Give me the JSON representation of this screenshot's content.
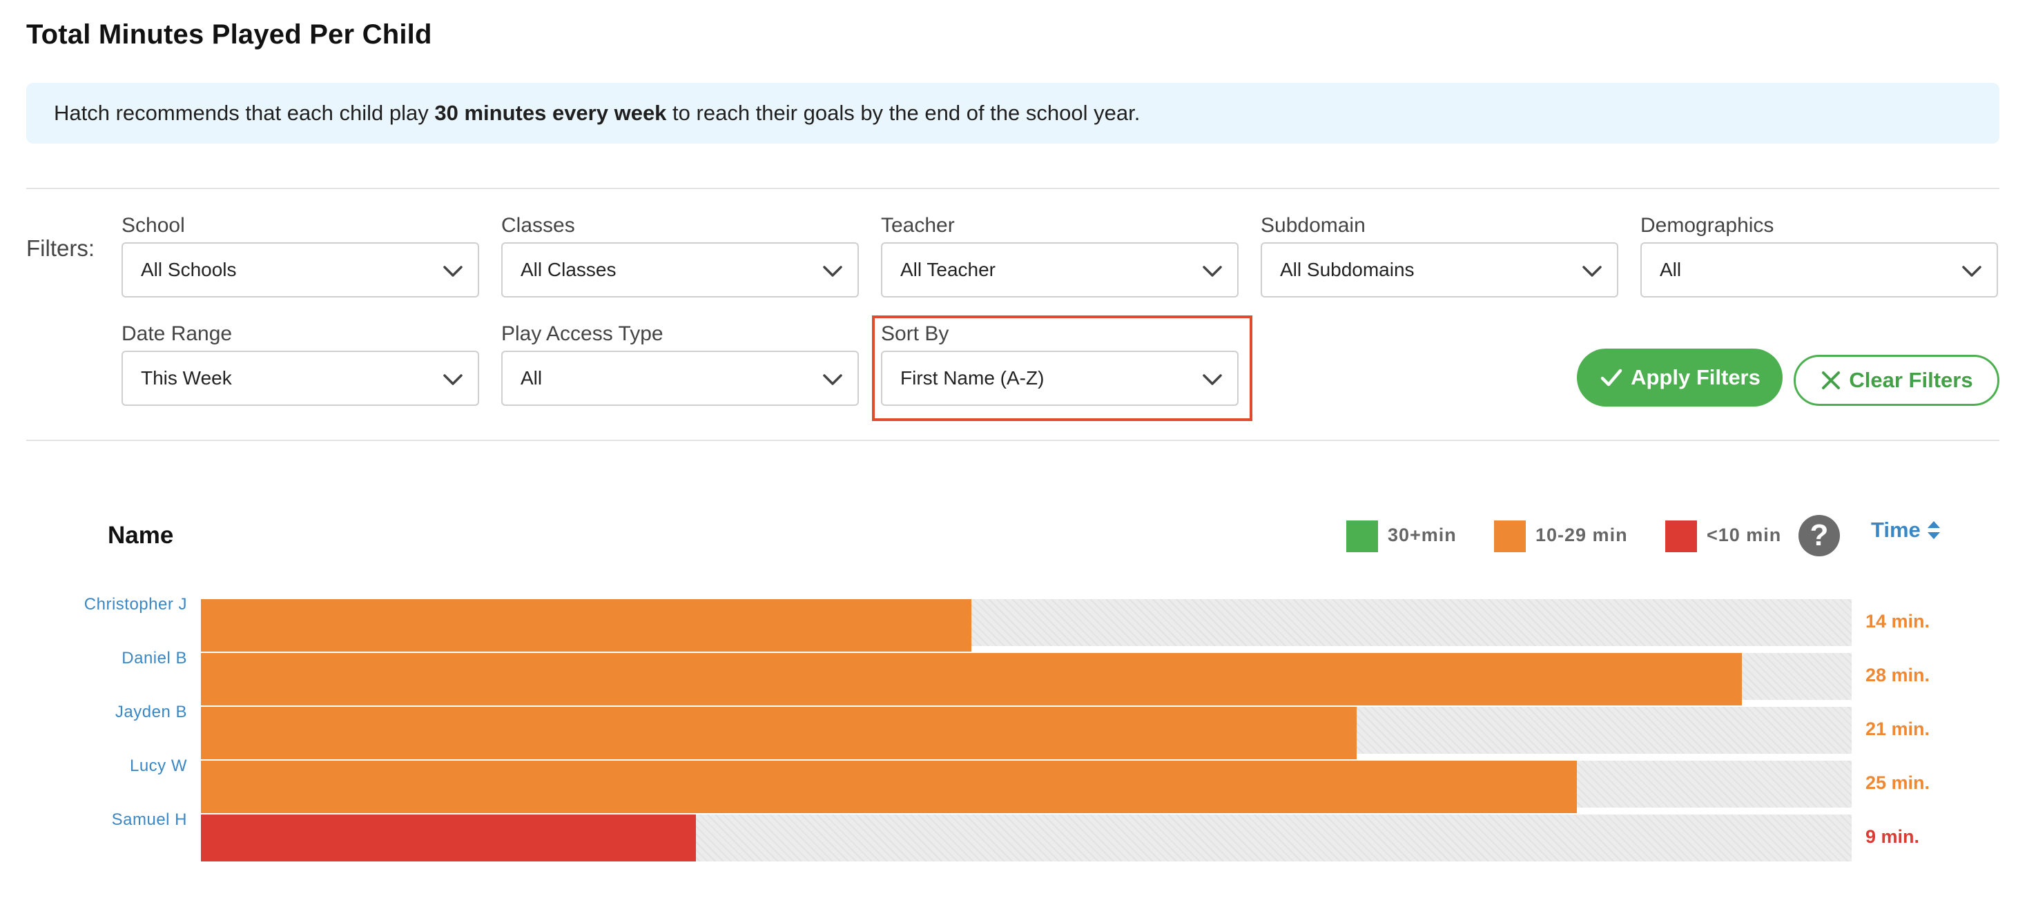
{
  "page": {
    "title": "Total Minutes Played Per Child"
  },
  "banner": {
    "prefix": "Hatch recommends that each child play ",
    "bold": "30 minutes every week",
    "suffix": " to reach their goals by the end of the school year."
  },
  "filters": {
    "label": "Filters:",
    "school": {
      "label": "School",
      "value": "All Schools"
    },
    "classes": {
      "label": "Classes",
      "value": "All Classes"
    },
    "teacher": {
      "label": "Teacher",
      "value": "All Teacher"
    },
    "subdomain": {
      "label": "Subdomain",
      "value": "All Subdomains"
    },
    "demographics": {
      "label": "Demographics",
      "value": "All"
    },
    "date_range": {
      "label": "Date Range",
      "value": "This Week"
    },
    "play_access_type": {
      "label": "Play Access Type",
      "value": "All"
    },
    "sort_by": {
      "label": "Sort By",
      "value": "First Name (A-Z)"
    },
    "apply_label": "Apply Filters",
    "clear_label": "Clear Filters"
  },
  "chart_header": {
    "name_label": "Name",
    "time_label": "Time",
    "legend": [
      {
        "label": "30+min",
        "color": "#4caf50"
      },
      {
        "label": "10-29 min",
        "color": "#ef8833"
      },
      {
        "label": "<10 min",
        "color": "#db3b33"
      }
    ],
    "help_icon": "question-circle-icon",
    "sort_icon": "sort-arrows-icon"
  },
  "chart_data": {
    "type": "bar",
    "orientation": "horizontal",
    "categories": [
      "Christopher J",
      "Daniel B",
      "Jayden B",
      "Lucy W",
      "Samuel H"
    ],
    "values": [
      14,
      28,
      21,
      25,
      9
    ],
    "value_labels": [
      "14 min.",
      "28 min.",
      "21 min.",
      "25 min.",
      "9 min."
    ],
    "xlim": [
      0,
      30
    ],
    "colors": [
      "#ef8833",
      "#ef8833",
      "#ef8833",
      "#ef8833",
      "#db3b33"
    ]
  },
  "colors": {
    "accent_green": "#4caf50",
    "link_blue": "#3a87c6",
    "highlight_red": "#e04a2d",
    "banner_bg": "#eaf6fd"
  }
}
